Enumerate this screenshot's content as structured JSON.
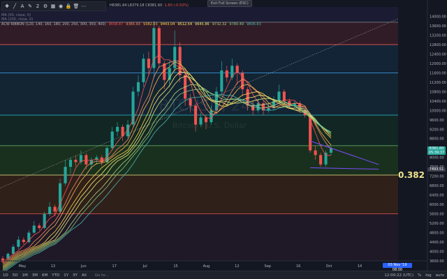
{
  "toolbar": {
    "items": [
      {
        "name": "crosshair-icon",
        "glyph": "✚"
      },
      {
        "name": "trendline-icon",
        "glyph": "╱"
      },
      {
        "name": "text-icon",
        "glyph": "A"
      },
      {
        "name": "pencil-icon",
        "glyph": "✎"
      },
      {
        "name": "line-width-value",
        "glyph": "2"
      },
      {
        "name": "settings-icon",
        "glyph": "⚙"
      },
      {
        "name": "templates-icon",
        "glyph": "▦"
      },
      {
        "name": "eye-icon",
        "glyph": "◉"
      },
      {
        "name": "lock-icon",
        "glyph": "🔒"
      },
      {
        "name": "trash-icon",
        "glyph": "🗑"
      },
      {
        "name": "more-icon",
        "glyph": "⋯"
      }
    ]
  },
  "exit_fullscreen": "Exit Full Screen (ESC)",
  "ohlc": {
    "text": "H8381.64  L8379.18  C8381.60",
    "change": "-1.60 (-0.02%)"
  },
  "indicators": [
    {
      "label": "MA (50, close, 0)"
    },
    {
      "label": "MA (200, close, 0)"
    }
  ],
  "ribbon": {
    "label": "ACW RIBBON (120, 140, 160, 180, 200, 250, 300, 350, 400)",
    "values": [
      {
        "v": "9558.87",
        "color": "#ff5252"
      },
      {
        "v": "9365.93",
        "color": "#ff8a65"
      },
      {
        "v": "9382.03",
        "color": "#ffb74d"
      },
      {
        "v": "9443.04",
        "color": "#ffd54f"
      },
      {
        "v": "9512.54",
        "color": "#fff176"
      },
      {
        "v": "9645.86",
        "color": "#dce775"
      },
      {
        "v": "9732.32",
        "color": "#aed581"
      },
      {
        "v": "9780.49",
        "color": "#81c784"
      },
      {
        "v": "9806.83",
        "color": "#4db6ac"
      }
    ]
  },
  "colors": {
    "background": "#131722",
    "candle_up": "#26a69a",
    "candle_down": "#ef5350",
    "fib_line": "#f0e68c",
    "wedge": "#7b4dff"
  },
  "fib_label": "0.382",
  "price_badges": [
    {
      "label": "8381.60",
      "price": 8381.6,
      "color": "#26a69a"
    },
    {
      "label": "05:39:37",
      "price": 8200,
      "color": "#26a69a"
    },
    {
      "label": "7493.51",
      "price": 7493.51,
      "color": "#3a3e4a"
    }
  ],
  "watermark": {
    "symbol": "BTCUSD, 240",
    "name": "Bitcoin / U.S. Dollar"
  },
  "bottom": {
    "ranges": [
      "1D",
      "5D",
      "1M",
      "3M",
      "6M",
      "YTD",
      "1Y",
      "3Y",
      "All"
    ],
    "goto": "Go to...",
    "time": "12:00:22 (UTC)",
    "pct": "%",
    "log": "log",
    "auto": "auto",
    "date_badge": "03 Nov '19",
    "date_badge_time": "08:00"
  },
  "chart_data": {
    "type": "candlestick",
    "y_axis": {
      "min": 3600,
      "max": 14400,
      "ticks": [
        14000,
        13600,
        13200,
        12800,
        12400,
        12000,
        11600,
        11200,
        10800,
        10400,
        10000,
        9600,
        9200,
        8800,
        8400,
        8000,
        7600,
        7200,
        6800,
        6400,
        6000,
        5600,
        5200,
        4800,
        4400,
        4000,
        3600
      ]
    },
    "x_axis": {
      "labels": [
        "May",
        "13",
        "Jun",
        "17",
        "Jul",
        "15",
        "Aug",
        "12",
        "Sep",
        "16",
        "Oct",
        "14"
      ]
    },
    "fib_levels": [
      13750,
      12800,
      11600,
      9800,
      8500,
      7250,
      5600
    ],
    "band_colors": [
      "#1f1f3a",
      "#3b1f2a",
      "#132a3d",
      "#14293a",
      "#132d24",
      "#1e3a1e",
      "#3a2418",
      "#241a2a"
    ],
    "candles": [
      [
        3700,
        3550,
        3800,
        3500
      ],
      [
        3700,
        3900,
        3960,
        3650
      ],
      [
        3900,
        4200,
        4300,
        3850
      ],
      [
        4200,
        4500,
        4650,
        4100
      ],
      [
        4500,
        4400,
        4600,
        4300
      ],
      [
        4400,
        4800,
        4900,
        4350
      ],
      [
        4800,
        5100,
        5300,
        4750
      ],
      [
        5100,
        5000,
        5200,
        4900
      ],
      [
        5000,
        5600,
        5700,
        4950
      ],
      [
        5600,
        5900,
        6100,
        5500
      ],
      [
        5900,
        5700,
        6000,
        5500
      ],
      [
        5700,
        6900,
        7100,
        5650
      ],
      [
        6900,
        7600,
        7900,
        6800
      ],
      [
        7600,
        7900,
        8000,
        7300
      ],
      [
        7900,
        7800,
        8100,
        7600
      ],
      [
        7800,
        8100,
        8300,
        7700
      ],
      [
        8100,
        7700,
        8200,
        7500
      ],
      [
        7700,
        7900,
        8000,
        7500
      ],
      [
        7900,
        8000,
        8100,
        7700
      ],
      [
        8000,
        7800,
        8100,
        7650
      ],
      [
        7800,
        8400,
        8500,
        7750
      ],
      [
        8400,
        9100,
        9300,
        8300
      ],
      [
        9100,
        9300,
        9500,
        8900
      ],
      [
        9300,
        8900,
        9400,
        8700
      ],
      [
        8900,
        9400,
        9600,
        8800
      ],
      [
        9400,
        10800,
        11000,
        9300
      ],
      [
        10800,
        11200,
        11500,
        10600
      ],
      [
        11200,
        12200,
        12400,
        11000
      ],
      [
        12200,
        11800,
        12500,
        11500
      ],
      [
        11800,
        13500,
        13800,
        11400
      ],
      [
        13500,
        12000,
        13600,
        11800
      ],
      [
        12000,
        11300,
        12100,
        10900
      ],
      [
        11300,
        11800,
        12100,
        11000
      ],
      [
        11800,
        12700,
        13400,
        11600
      ],
      [
        12700,
        11500,
        12900,
        11200
      ],
      [
        11500,
        10500,
        11700,
        10200
      ],
      [
        10500,
        10200,
        10700,
        9900
      ],
      [
        10200,
        9400,
        10300,
        9100
      ],
      [
        9400,
        9700,
        9900,
        9300
      ],
      [
        9700,
        9500,
        9800,
        9200
      ],
      [
        9500,
        10000,
        10200,
        9400
      ],
      [
        10000,
        10800,
        11000,
        9900
      ],
      [
        10800,
        11700,
        12100,
        10700
      ],
      [
        11700,
        11400,
        11900,
        11200
      ],
      [
        11400,
        11900,
        12200,
        11300
      ],
      [
        11900,
        11600,
        12000,
        11100
      ],
      [
        11600,
        10900,
        11700,
        10600
      ],
      [
        10900,
        10200,
        11000,
        10000
      ],
      [
        10200,
        10000,
        10400,
        9800
      ],
      [
        10000,
        10300,
        10500,
        9900
      ],
      [
        10300,
        10000,
        10400,
        9800
      ],
      [
        10000,
        10100,
        10300,
        9900
      ],
      [
        10100,
        10400,
        10600,
        10000
      ],
      [
        10400,
        10800,
        11100,
        10300
      ],
      [
        10800,
        10400,
        10900,
        10200
      ],
      [
        10400,
        10200,
        10500,
        10100
      ],
      [
        10200,
        10300,
        10400,
        10100
      ],
      [
        10300,
        10000,
        10400,
        9900
      ],
      [
        10000,
        9800,
        10100,
        9700
      ],
      [
        9800,
        8300,
        9900,
        8200
      ],
      [
        8300,
        8100,
        8500,
        7900
      ],
      [
        8100,
        7700,
        8200,
        7600
      ],
      [
        7700,
        8200,
        8300,
        7600
      ],
      [
        8200,
        8380,
        8500,
        8100
      ]
    ]
  }
}
